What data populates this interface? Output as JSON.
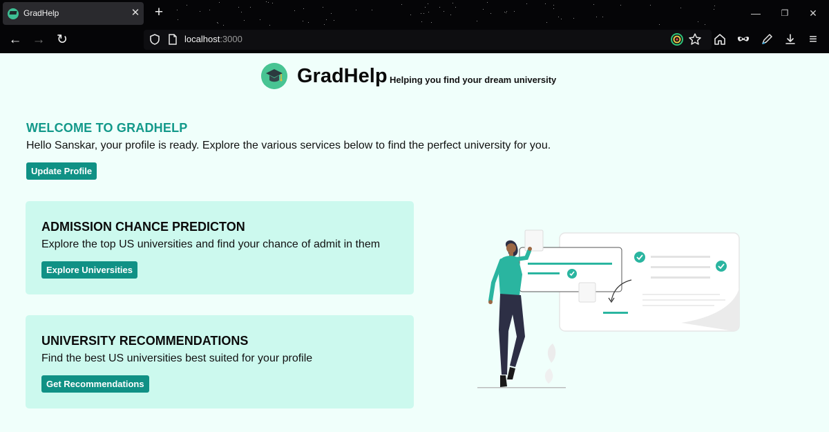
{
  "browser": {
    "tab_title": "GradHelp",
    "tab_close_glyph": "✕",
    "new_tab_glyph": "+",
    "url_host": "localhost",
    "url_port": ":3000",
    "window_controls": {
      "minimize": "—",
      "restore": "❐",
      "close": "✕"
    },
    "nav": {
      "back": "←",
      "forward": "→",
      "reload": "↻",
      "menu": "≡"
    },
    "icons": [
      "shield-icon",
      "page-icon",
      "extension-icon",
      "star-icon",
      "home-icon",
      "mask-icon",
      "pen-icon",
      "download-icon",
      "menu-icon"
    ]
  },
  "brand": {
    "name": "GradHelp",
    "tagline": "Helping you find your dream university",
    "logo_color": "#48c493"
  },
  "welcome": {
    "heading": "WELCOME TO GRADHELP",
    "message": "Hello Sanskar, your profile is ready. Explore the various services below to find the perfect university for you.",
    "update_profile_label": "Update Profile"
  },
  "cards": [
    {
      "title": "ADMISSION CHANCE PREDICTON",
      "description": "Explore the top US universities and find your chance of admit in them",
      "button_label": "Explore Universities"
    },
    {
      "title": "UNIVERSITY RECOMMENDATIONS",
      "description": "Find the best US universities best suited for your profile",
      "button_label": "Get Recommendations"
    }
  ],
  "colors": {
    "accent": "#109185",
    "heading_teal": "#13998a",
    "card_bg": "#ccf9ee",
    "page_bg": "#f0fffb",
    "illustration_teal": "#2ab5a0"
  }
}
